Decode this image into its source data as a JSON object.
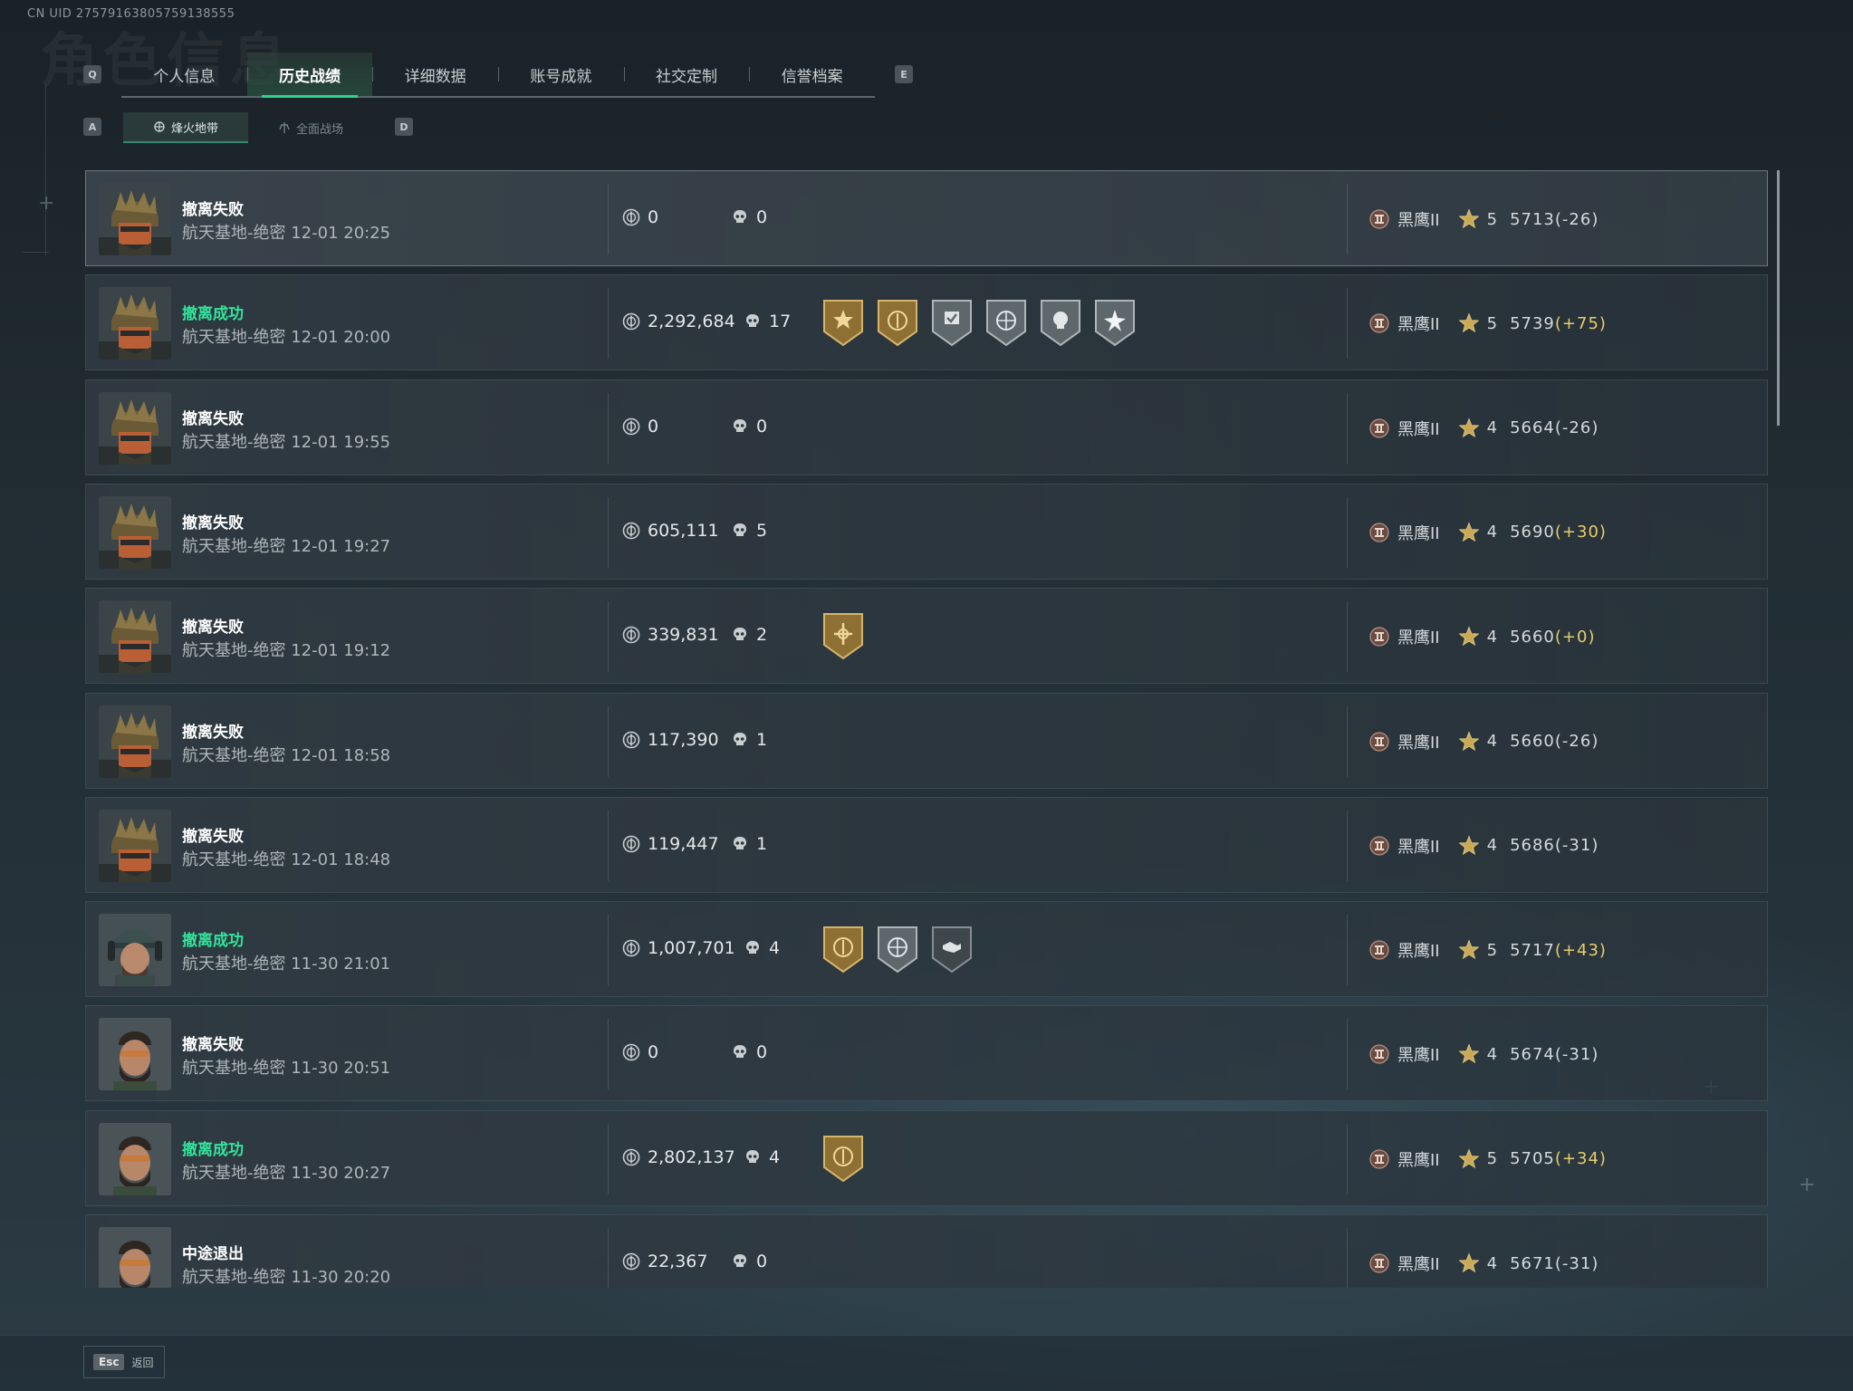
{
  "uid": "CN UID 2757916380575913855​5",
  "background_title": "角色信息",
  "keys": {
    "tab_prev": "Q",
    "tab_next": "E",
    "sub_prev": "A",
    "sub_next": "D"
  },
  "tabs": [
    {
      "label": "个人信息",
      "active": false
    },
    {
      "label": "历史战绩",
      "active": true
    },
    {
      "label": "详细数据",
      "active": false
    },
    {
      "label": "账号成就",
      "active": false
    },
    {
      "label": "社交定制",
      "active": false
    },
    {
      "label": "信誉档案",
      "active": false
    }
  ],
  "subtabs": [
    {
      "label": "烽火地带",
      "icon": "mode-icon",
      "active": true
    },
    {
      "label": "全面战场",
      "icon": "battlefield-icon",
      "active": false
    }
  ],
  "matches": [
    {
      "status": "撤离失败",
      "success": false,
      "map": "航天基地-绝密",
      "time": "12-01 20:25",
      "value": "0",
      "kills": "0",
      "badges": [],
      "rank": "黑鹰II",
      "stars": "5",
      "score": "5713",
      "delta": "(-26)",
      "delta_type": "neg",
      "avatar": "helmet"
    },
    {
      "status": "撤离成功",
      "success": true,
      "map": "航天基地-绝密",
      "time": "12-01 20:00",
      "value": "2,292,684",
      "kills": "17",
      "badges": [
        "gold-sun-badge",
        "gold-coin-badge",
        "silver-check-badge",
        "silver-target-badge",
        "silver-skull-badge",
        "silver-star-badge"
      ],
      "rank": "黑鹰II",
      "stars": "5",
      "score": "5739",
      "delta": "(+75)",
      "delta_type": "pos",
      "avatar": "helmet"
    },
    {
      "status": "撤离失败",
      "success": false,
      "map": "航天基地-绝密",
      "time": "12-01 19:55",
      "value": "0",
      "kills": "0",
      "badges": [],
      "rank": "黑鹰II",
      "stars": "4",
      "score": "5664",
      "delta": "(-26)",
      "delta_type": "neg",
      "avatar": "helmet"
    },
    {
      "status": "撤离失败",
      "success": false,
      "map": "航天基地-绝密",
      "time": "12-01 19:27",
      "value": "605,111",
      "kills": "5",
      "badges": [],
      "rank": "黑鹰II",
      "stars": "4",
      "score": "5690",
      "delta": "(+30)",
      "delta_type": "pos",
      "avatar": "helmet"
    },
    {
      "status": "撤离失败",
      "success": false,
      "map": "航天基地-绝密",
      "time": "12-01 19:12",
      "value": "339,831",
      "kills": "2",
      "badges": [
        "gold-cross-badge"
      ],
      "rank": "黑鹰II",
      "stars": "4",
      "score": "5660",
      "delta": "(+0)",
      "delta_type": "pos",
      "avatar": "helmet"
    },
    {
      "status": "撤离失败",
      "success": false,
      "map": "航天基地-绝密",
      "time": "12-01 18:58",
      "value": "117,390",
      "kills": "1",
      "badges": [],
      "rank": "黑鹰II",
      "stars": "4",
      "score": "5660",
      "delta": "(-26)",
      "delta_type": "neg",
      "avatar": "helmet"
    },
    {
      "status": "撤离失败",
      "success": false,
      "map": "航天基地-绝密",
      "time": "12-01 18:48",
      "value": "119,447",
      "kills": "1",
      "badges": [],
      "rank": "黑鹰II",
      "stars": "4",
      "score": "5686",
      "delta": "(-31)",
      "delta_type": "neg",
      "avatar": "helmet"
    },
    {
      "status": "撤离成功",
      "success": true,
      "map": "航天基地-绝密",
      "time": "11-30 21:01",
      "value": "1,007,701",
      "kills": "4",
      "badges": [
        "gold-coin-badge",
        "silver-target-badge",
        "dark-handshake-badge"
      ],
      "rank": "黑鹰II",
      "stars": "5",
      "score": "5717",
      "delta": "(+43)",
      "delta_type": "pos",
      "avatar": "cap"
    },
    {
      "status": "撤离失败",
      "success": false,
      "map": "航天基地-绝密",
      "time": "11-30 20:51",
      "value": "0",
      "kills": "0",
      "badges": [],
      "rank": "黑鹰II",
      "stars": "4",
      "score": "5674",
      "delta": "(-31)",
      "delta_type": "neg",
      "avatar": "beard"
    },
    {
      "status": "撤离成功",
      "success": true,
      "map": "航天基地-绝密",
      "time": "11-30 20:27",
      "value": "2,802,137",
      "kills": "4",
      "badges": [
        "gold-coin-badge"
      ],
      "rank": "黑鹰II",
      "stars": "5",
      "score": "5705",
      "delta": "(+34)",
      "delta_type": "pos",
      "avatar": "beard"
    },
    {
      "status": "中途退出",
      "success": false,
      "map": "航天基地-绝密",
      "time": "11-30 20:20",
      "value": "22,367",
      "kills": "0",
      "badges": [],
      "rank": "黑鹰II",
      "stars": "4",
      "score": "5671",
      "delta": "(-31)",
      "delta_type": "neg",
      "avatar": "beard"
    }
  ],
  "footer": {
    "esc_key": "Esc",
    "esc_label": "返回"
  },
  "colors": {
    "accent": "#2fd38e",
    "success": "#33e49a",
    "gold": "#e7cd6a",
    "badge_gold": "#9c7b3a",
    "badge_silver": "#6b7378"
  }
}
